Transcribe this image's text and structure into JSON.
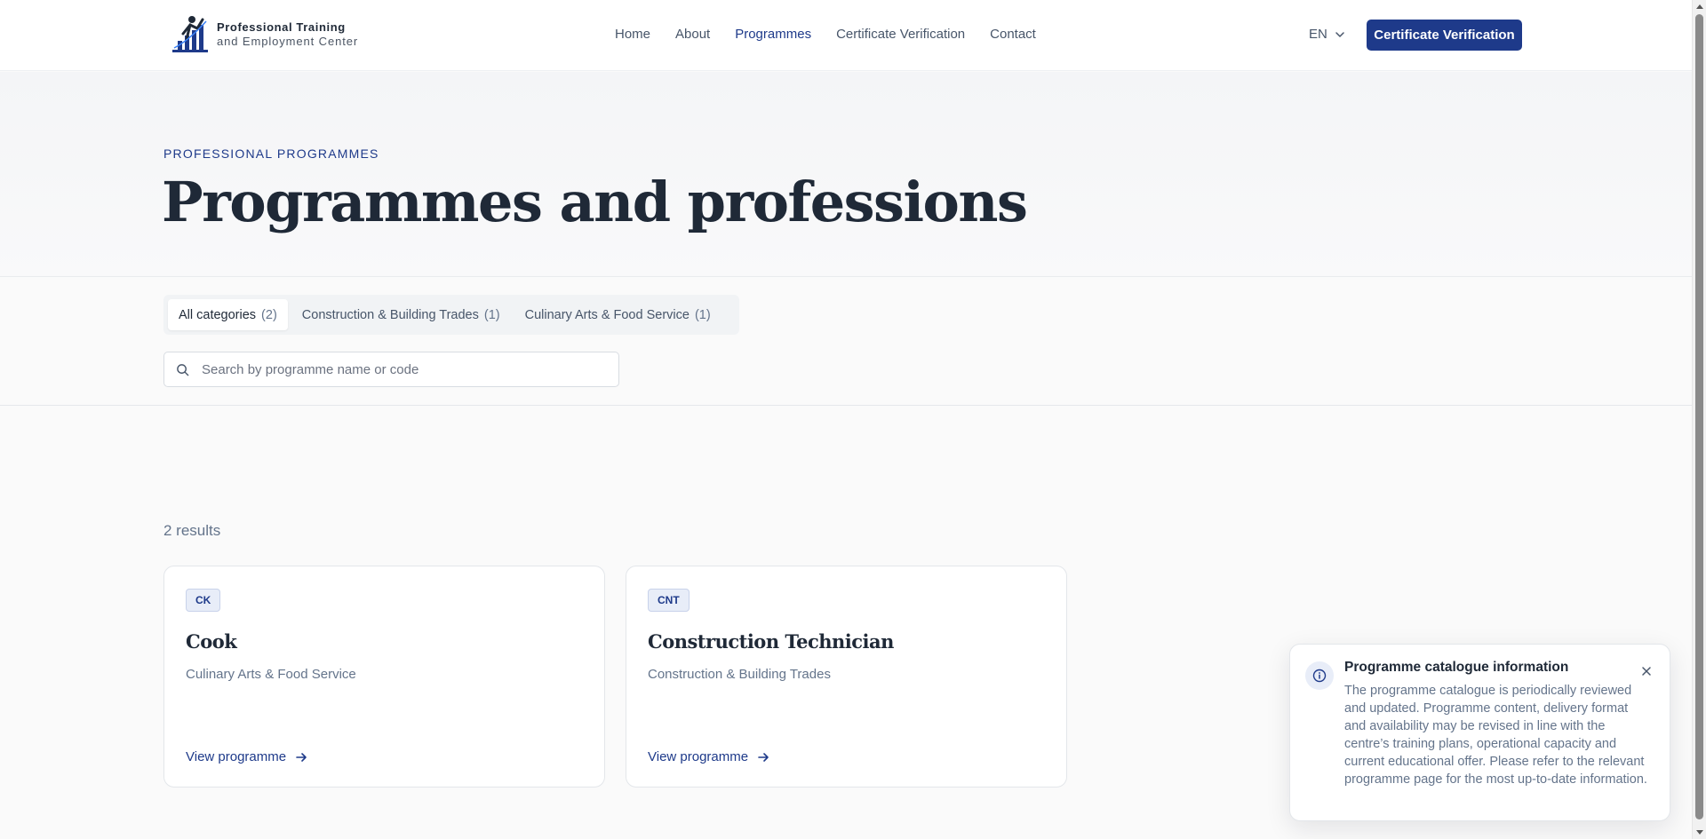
{
  "brand": {
    "line1": "Professional Training",
    "line2": "and Employment Center",
    "logo_icon": "climbing-figure-chart-logo"
  },
  "nav": {
    "items": [
      {
        "label": "Home",
        "active": false
      },
      {
        "label": "About",
        "active": false
      },
      {
        "label": "Programmes",
        "active": true
      },
      {
        "label": "Certificate Verification",
        "active": false
      },
      {
        "label": "Contact",
        "active": false
      }
    ]
  },
  "header": {
    "language": "EN",
    "language_icon": "chevron-down-icon",
    "cta_label": "Certificate Verification"
  },
  "hero": {
    "eyebrow": "Professional programmes",
    "title": "Programmes and professions"
  },
  "filters": {
    "tabs": [
      {
        "label": "All categories",
        "count": "(2)",
        "active": true
      },
      {
        "label": "Construction & Building Trades",
        "count": "(1)",
        "active": false
      },
      {
        "label": "Culinary Arts & Food Service",
        "count": "(1)",
        "active": false
      }
    ],
    "search": {
      "placeholder": "Search by programme name or code",
      "value": "",
      "icon": "search-icon"
    }
  },
  "results": {
    "count_label": "2 results",
    "cards": [
      {
        "code": "CK",
        "title": "Cook",
        "category": "Culinary Arts & Food Service",
        "link_label": "View programme"
      },
      {
        "code": "CNT",
        "title": "Construction Technician",
        "category": "Construction & Building Trades",
        "link_label": "View programme"
      }
    ]
  },
  "toast": {
    "icon": "info-icon",
    "title": "Programme catalogue information",
    "body": "The programme catalogue is periodically reviewed and updated. Programme content, delivery format and availability may be revised in line with the centre’s training plans, operational capacity and current educational offer. Please refer to the relevant programme page for the most up-to-date information.",
    "close_icon": "close-icon"
  },
  "colors": {
    "primary": "#1e3a8a",
    "text": "#1f2937",
    "muted": "#64748b",
    "background": "#fafafa"
  }
}
